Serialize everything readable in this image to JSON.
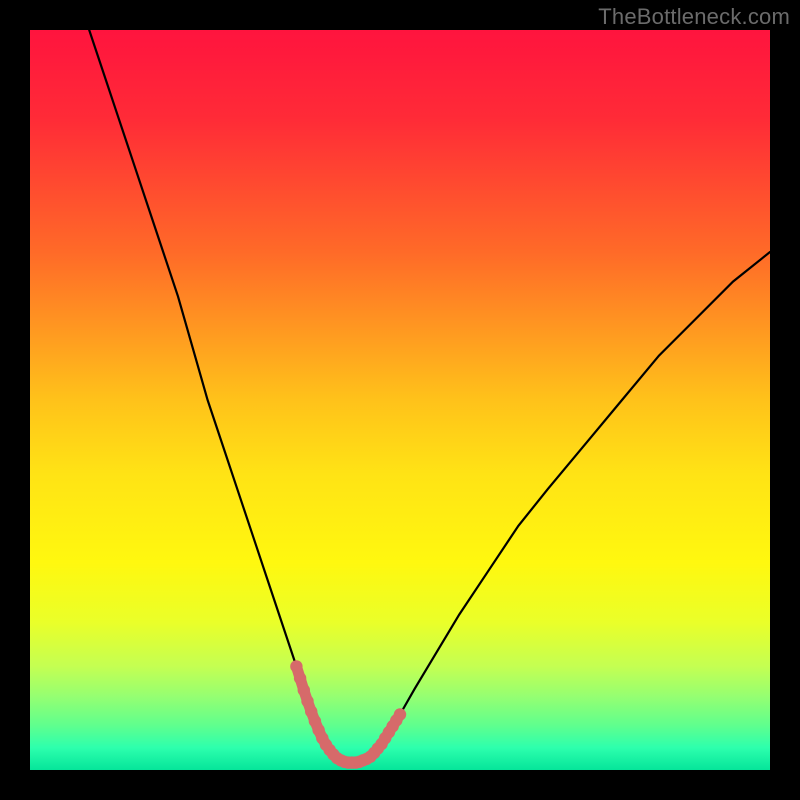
{
  "watermark": "TheBottleneck.com",
  "chart_data": {
    "type": "line",
    "title": "",
    "xlabel": "",
    "ylabel": "",
    "xlim": [
      0,
      100
    ],
    "ylim": [
      0,
      100
    ],
    "grid": false,
    "legend": false,
    "series": [
      {
        "name": "bottleneck-curve",
        "x": [
          8,
          10,
          12,
          14,
          16,
          18,
          20,
          22,
          24,
          26,
          28,
          30,
          32,
          34,
          36,
          37,
          38,
          39,
          40,
          41,
          42,
          43,
          44,
          45,
          46,
          47,
          48,
          50,
          52,
          55,
          58,
          62,
          66,
          70,
          75,
          80,
          85,
          90,
          95,
          100
        ],
        "y": [
          100,
          94,
          88,
          82,
          76,
          70,
          64,
          57,
          50,
          44,
          38,
          32,
          26,
          20,
          14,
          11,
          8,
          5.5,
          3.5,
          2.2,
          1.4,
          1.0,
          1.0,
          1.2,
          1.8,
          2.8,
          4.2,
          7.5,
          11,
          16,
          21,
          27,
          33,
          38,
          44,
          50,
          56,
          61,
          66,
          70
        ]
      }
    ],
    "highlight": {
      "name": "flat-zone",
      "color": "#d66a6a",
      "points_x": [
        36.0,
        36.5,
        37.0,
        37.5,
        38.0,
        38.5,
        39.0,
        39.5,
        40.0,
        40.5,
        41.0,
        41.5,
        42.0,
        42.5,
        43.0,
        43.5,
        44.0,
        44.5,
        45.0,
        45.5,
        46.0,
        46.5,
        47.0,
        47.5,
        48.0,
        48.5,
        49.0,
        49.5,
        50.0
      ],
      "points_y": [
        14.0,
        12.4,
        10.8,
        9.3,
        7.9,
        6.6,
        5.4,
        4.3,
        3.4,
        2.7,
        2.1,
        1.6,
        1.3,
        1.1,
        1.0,
        1.0,
        1.0,
        1.1,
        1.3,
        1.5,
        1.8,
        2.3,
        2.9,
        3.5,
        4.3,
        5.1,
        5.9,
        6.7,
        7.5
      ]
    },
    "gradient_stops": [
      {
        "offset": 0.0,
        "color": "#ff143e"
      },
      {
        "offset": 0.12,
        "color": "#ff2b37"
      },
      {
        "offset": 0.3,
        "color": "#ff6a28"
      },
      {
        "offset": 0.5,
        "color": "#ffc21a"
      },
      {
        "offset": 0.6,
        "color": "#ffe315"
      },
      {
        "offset": 0.72,
        "color": "#fff80f"
      },
      {
        "offset": 0.8,
        "color": "#eaff29"
      },
      {
        "offset": 0.86,
        "color": "#c4ff52"
      },
      {
        "offset": 0.9,
        "color": "#96ff71"
      },
      {
        "offset": 0.94,
        "color": "#5fff8e"
      },
      {
        "offset": 0.97,
        "color": "#2dffad"
      },
      {
        "offset": 1.0,
        "color": "#05e59a"
      }
    ]
  }
}
